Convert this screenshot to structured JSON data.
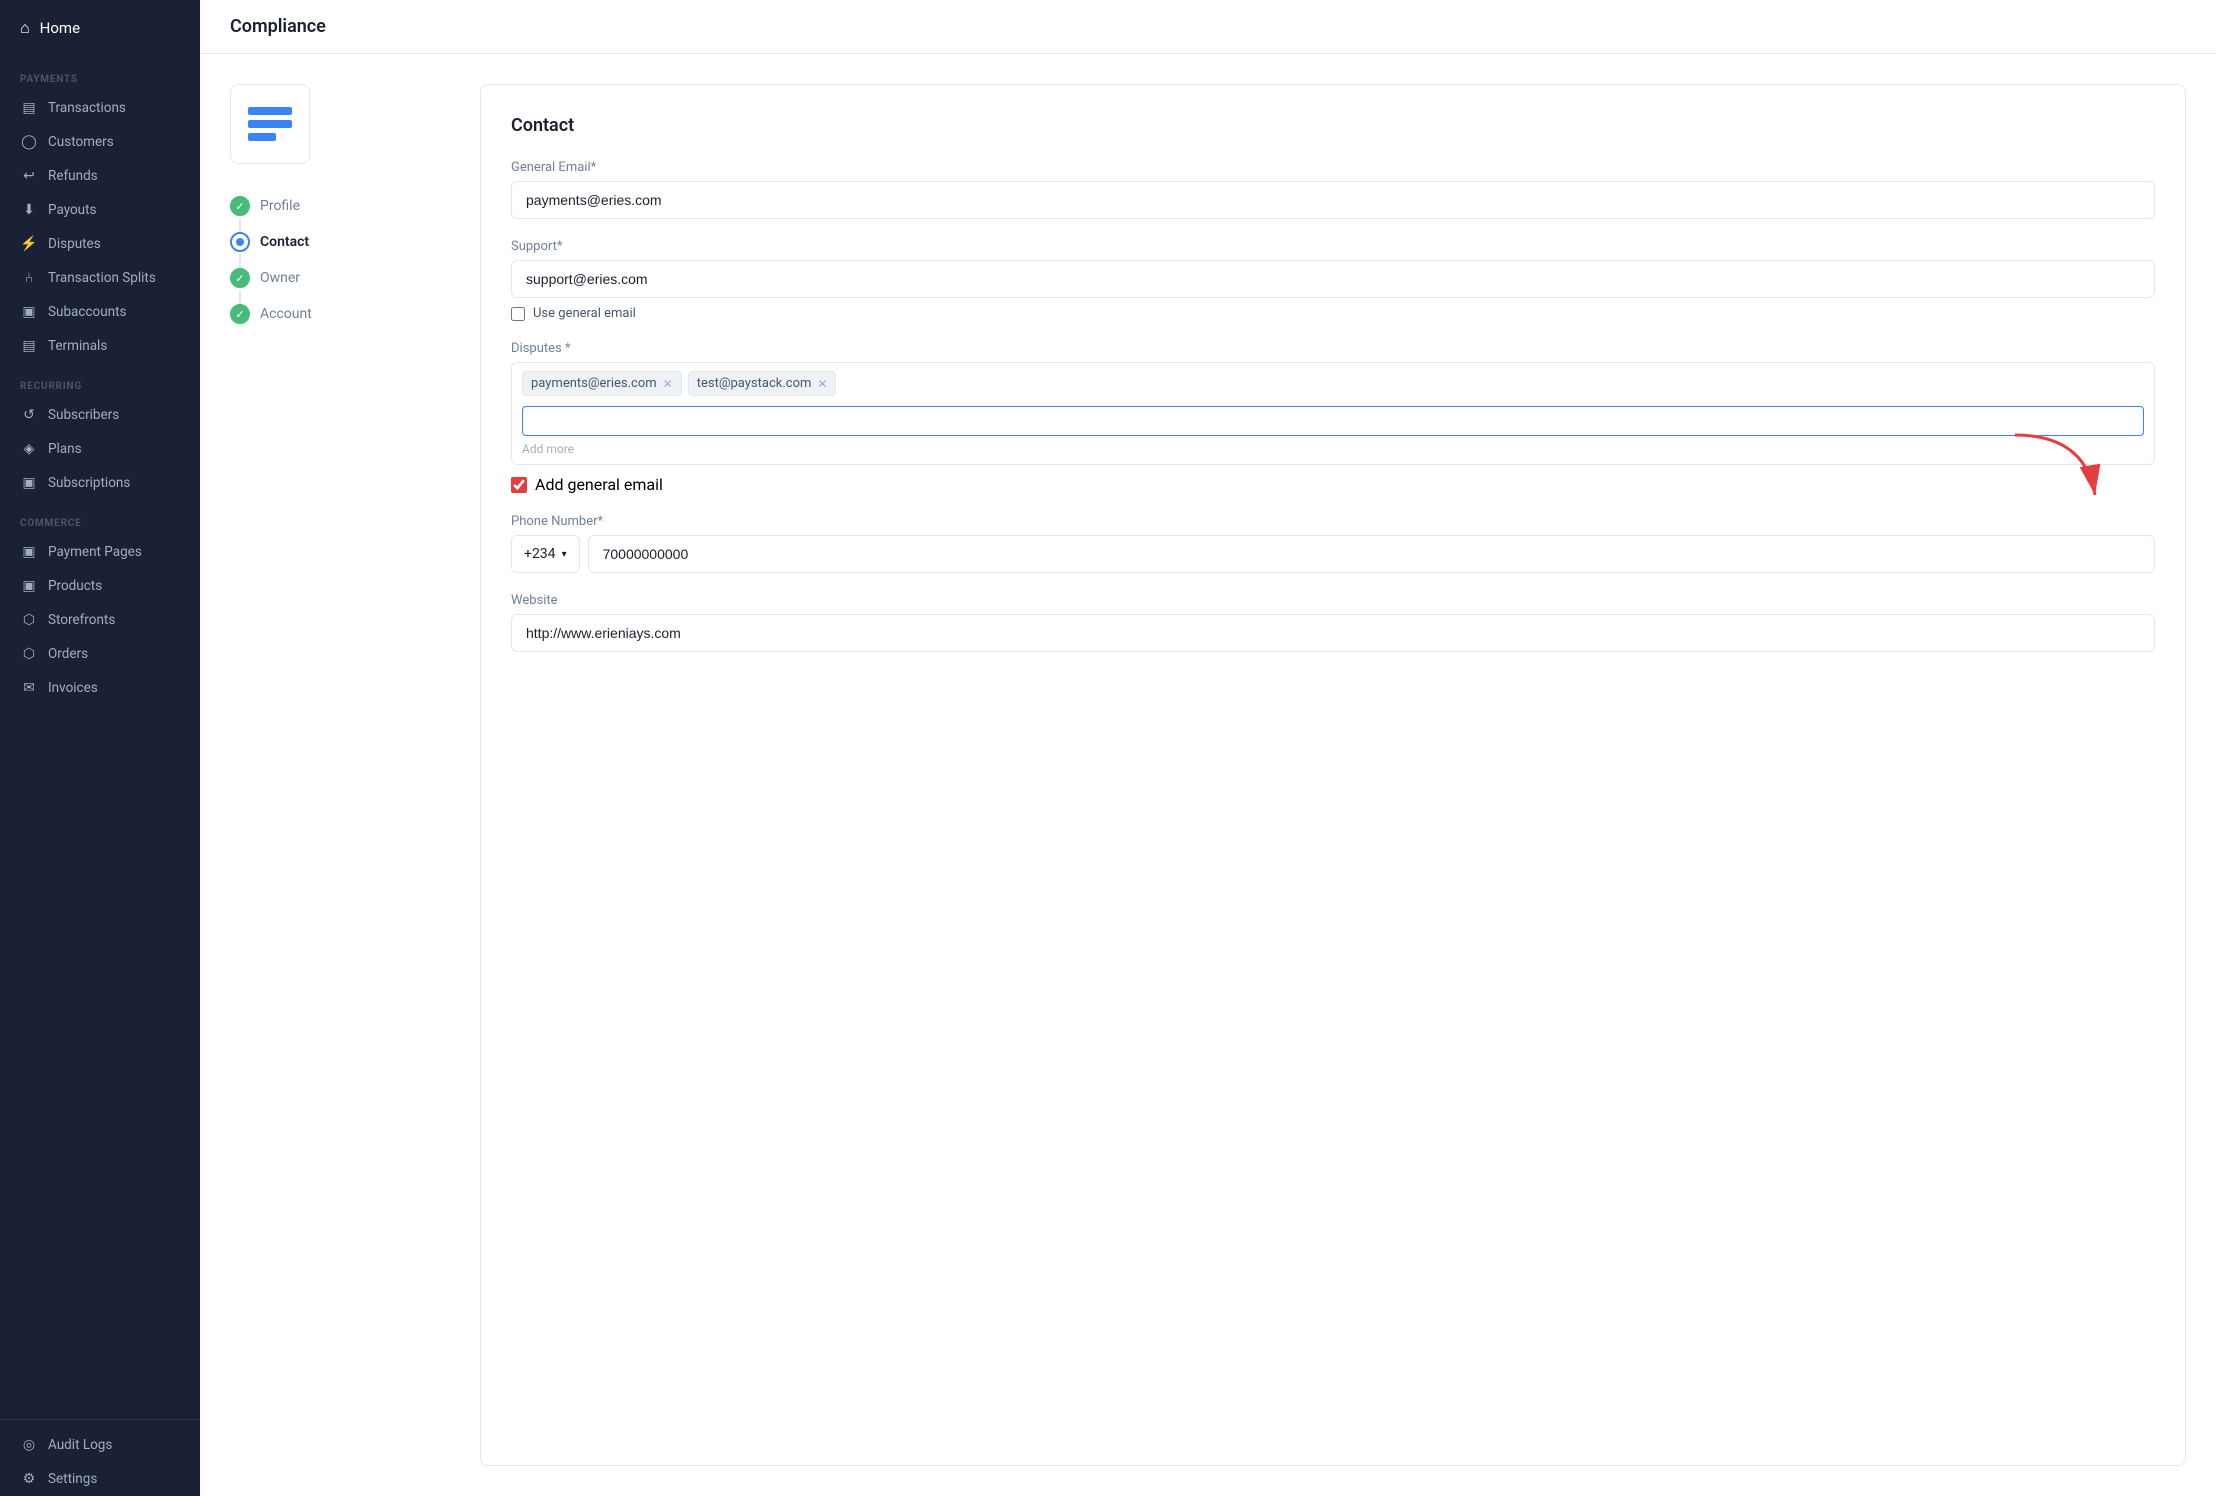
{
  "sidebar": {
    "home": "Home",
    "sections": [
      {
        "label": "PAYMENTS",
        "items": [
          {
            "name": "transactions",
            "icon": "▤",
            "label": "Transactions"
          },
          {
            "name": "customers",
            "icon": "👤",
            "label": "Customers"
          },
          {
            "name": "refunds",
            "icon": "↩",
            "label": "Refunds"
          },
          {
            "name": "payouts",
            "icon": "⬇",
            "label": "Payouts"
          },
          {
            "name": "disputes",
            "icon": "⚡",
            "label": "Disputes"
          },
          {
            "name": "transaction-splits",
            "icon": "⑂",
            "label": "Transaction Splits"
          },
          {
            "name": "subaccounts",
            "icon": "▣",
            "label": "Subaccounts"
          },
          {
            "name": "terminals",
            "icon": "▤",
            "label": "Terminals"
          }
        ]
      },
      {
        "label": "RECURRING",
        "items": [
          {
            "name": "subscribers",
            "icon": "↺",
            "label": "Subscribers"
          },
          {
            "name": "plans",
            "icon": "◈",
            "label": "Plans"
          },
          {
            "name": "subscriptions",
            "icon": "▣",
            "label": "Subscriptions"
          }
        ]
      },
      {
        "label": "COMMERCE",
        "items": [
          {
            "name": "payment-pages",
            "icon": "▣",
            "label": "Payment Pages"
          },
          {
            "name": "products",
            "icon": "▣",
            "label": "Products"
          },
          {
            "name": "storefronts",
            "icon": "🏪",
            "label": "Storefronts"
          },
          {
            "name": "orders",
            "icon": "🛒",
            "label": "Orders"
          },
          {
            "name": "invoices",
            "icon": "✉",
            "label": "Invoices"
          }
        ]
      }
    ],
    "bottom": [
      {
        "name": "audit-logs",
        "icon": "◎",
        "label": "Audit Logs"
      },
      {
        "name": "settings",
        "icon": "⚙",
        "label": "Settings"
      }
    ]
  },
  "header": {
    "title": "Compliance"
  },
  "steps": [
    {
      "name": "profile",
      "label": "Profile",
      "status": "complete"
    },
    {
      "name": "contact",
      "label": "Contact",
      "status": "active"
    },
    {
      "name": "owner",
      "label": "Owner",
      "status": "complete"
    },
    {
      "name": "account",
      "label": "Account",
      "status": "complete"
    }
  ],
  "form": {
    "title": "Contact",
    "general_email_label": "General Email*",
    "general_email_value": "payments@eries.com",
    "support_label": "Support*",
    "support_value": "support@eries.com",
    "use_general_email_label": "Use general email",
    "disputes_label": "Disputes *",
    "dispute_tags": [
      "payments@eries.com",
      "test@paystack.com"
    ],
    "add_more_placeholder": "Add more",
    "add_general_email_label": "Add general email",
    "phone_label": "Phone Number*",
    "phone_country_code": "+234",
    "phone_number": "70000000000",
    "website_label": "Website",
    "website_value": "http://www.erieniays.com"
  }
}
